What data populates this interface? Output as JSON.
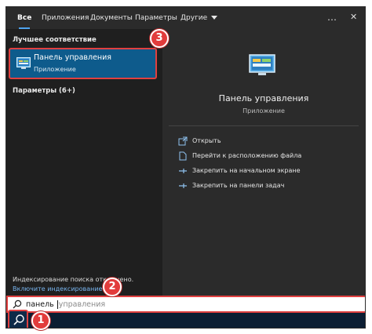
{
  "tabs": [
    {
      "label": "Все"
    },
    {
      "label": "Приложения"
    },
    {
      "label": "Документы"
    },
    {
      "label": "Параметры"
    },
    {
      "label": "Другие"
    }
  ],
  "top_icons": {
    "more": "…",
    "close": "✕"
  },
  "left_pane": {
    "best_match_title": "Лучшее соответствие",
    "best_match": {
      "title": "Панель управления",
      "subtitle": "Приложение",
      "icon": "control-panel-icon"
    },
    "settings_section": "Параметры (6+)",
    "index_note": "Индексирование поиска отключено.",
    "index_link": "Включите индексирование."
  },
  "right_pane": {
    "title": "Панель управления",
    "subtitle": "Приложение",
    "actions": [
      {
        "label": "Открыть",
        "icon": "open-icon"
      },
      {
        "label": "Перейти к расположению файла",
        "icon": "file-location-icon"
      },
      {
        "label": "Закрепить на начальном экране",
        "icon": "pin-icon"
      },
      {
        "label": "Закрепить на панели задач",
        "icon": "pin-icon"
      }
    ]
  },
  "search": {
    "typed": "панель ",
    "suggestion": "управления"
  },
  "badges": [
    "1",
    "2",
    "3"
  ],
  "colors": {
    "accent": "#0e5b8c",
    "highlight": "#e04040",
    "link": "#78b4ee"
  }
}
